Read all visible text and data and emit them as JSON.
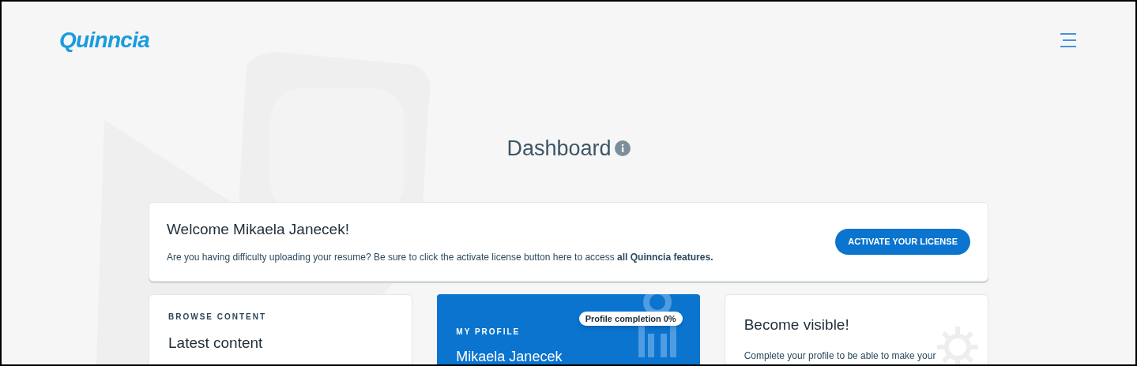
{
  "header": {
    "logo": "Quinncia"
  },
  "page_title": "Dashboard",
  "welcome": {
    "title": "Welcome Mikaela Janecek!",
    "message": "Are you having difficulty uploading your resume? Be sure to click the activate license button here to access **all Quinncia features.**",
    "button": "ACTIVATE YOUR LICENSE"
  },
  "cards": [
    {
      "kind": "content",
      "eyebrow": "BROWSE CONTENT",
      "title": "Latest content"
    },
    {
      "kind": "profile",
      "eyebrow": "MY PROFILE",
      "badge": "Profile completion 0%",
      "title": "Mikaela Janecek"
    },
    {
      "kind": "visibility",
      "title": "Become visible!",
      "text": "Complete your profile to be able to make your"
    }
  ]
}
